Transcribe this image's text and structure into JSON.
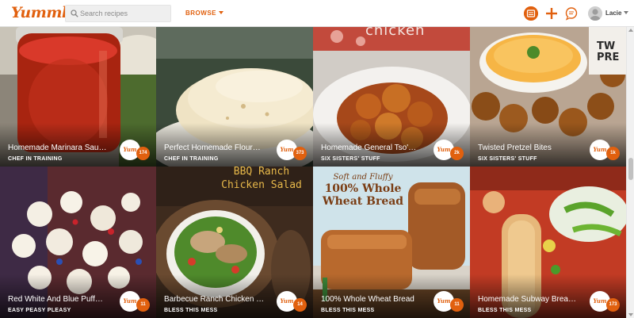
{
  "header": {
    "logo_text": "Yummly",
    "logo_tm": "™",
    "search_placeholder": "Search recipes",
    "browse_label": "BROWSE",
    "username": "Lacie"
  },
  "colors": {
    "accent": "#e1600e",
    "topbar_bg": "#ffffff"
  },
  "icons": {
    "yums": "yums-icon",
    "add": "plus-icon",
    "chat": "chat-bubble-icon",
    "search": "search-icon"
  },
  "recipes": [
    {
      "title": "Homemade Marinara Sau…",
      "source": "CHEF IN TRAINING",
      "yums": "174",
      "yum_label": "Yum"
    },
    {
      "title": "Perfect Homemade Flour…",
      "source": "CHEF IN TRAINING",
      "yums": "373",
      "yum_label": "Yum"
    },
    {
      "title": "Homemade General Tso'…",
      "source": "SIX SISTERS' STUFF",
      "yums": "2k",
      "yum_label": "Yum"
    },
    {
      "title": "Twisted Pretzel Bites",
      "source": "SIX SISTERS' STUFF",
      "yums": "1k",
      "yum_label": "Yum"
    },
    {
      "title": "Red White And Blue Puff…",
      "source": "EASY PEASY PLEASY",
      "yums": "11",
      "yum_label": "Yum"
    },
    {
      "title": "Barbecue Ranch Chicken …",
      "source": "BLESS THIS MESS",
      "yums": "14",
      "yum_label": "Yum"
    },
    {
      "title": "100% Whole Wheat Bread",
      "source": "BLESS THIS MESS",
      "yums": "11",
      "yum_label": "Yum"
    },
    {
      "title": "Homemade Subway Brea…",
      "source": "BLESS THIS MESS",
      "yums": "173",
      "yum_label": "Yum"
    }
  ],
  "image_text": {
    "general_tso": "chicken",
    "pretzel": "TW PRE",
    "salad_line1": "BBQ Ranch",
    "salad_line2": "Chicken Salad",
    "bread_line1": "Soft and Fluffy",
    "bread_line2": "100% Whole",
    "bread_line3": "Wheat Bread"
  }
}
